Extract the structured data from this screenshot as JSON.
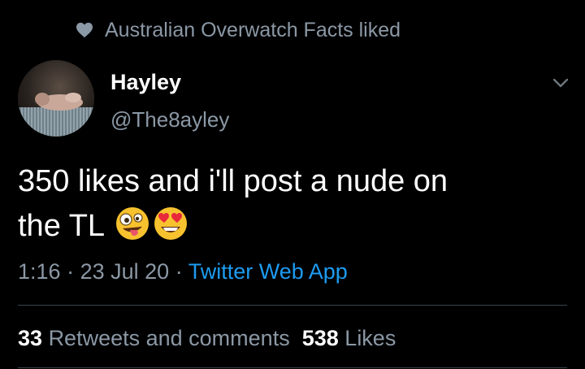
{
  "social_context": {
    "text": "Australian Overwatch Facts liked",
    "icon": "heart-icon"
  },
  "author": {
    "name": "Hayley",
    "handle": "@The8ayley"
  },
  "tweet": {
    "text_line1": "350 likes and i'll post a nude on",
    "text_line2": "the TL",
    "emojis": [
      "zany-face-emoji",
      "heart-eyes-emoji"
    ]
  },
  "meta": {
    "time": "1:16",
    "separator": "·",
    "date": "23 Jul 20",
    "source": "Twitter Web App"
  },
  "stats": {
    "retweets_count": "33",
    "retweets_label": "Retweets and comments",
    "likes_count": "538",
    "likes_label": "Likes"
  },
  "colors": {
    "background": "#000000",
    "secondary_text": "#8b98a5",
    "link": "#1d9bf0",
    "divider": "#38444d"
  }
}
